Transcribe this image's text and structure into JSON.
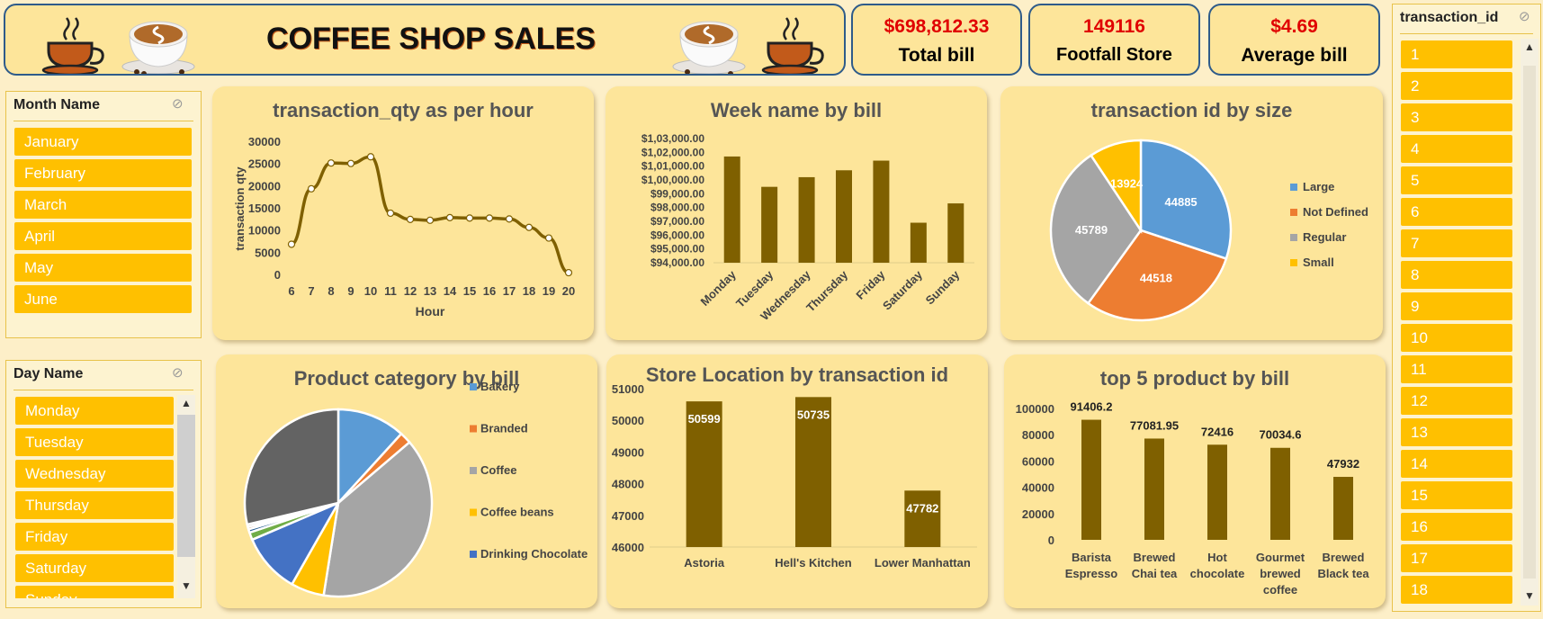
{
  "header": {
    "title": "COFFEE SHOP SALES"
  },
  "kpis": [
    {
      "value": "$698,812.33",
      "label": "Total bill"
    },
    {
      "value": "149116",
      "label": "Footfall Store"
    },
    {
      "value": "$4.69",
      "label": "Average bill"
    }
  ],
  "colors": {
    "card": "#fde59a",
    "bar": "#7f6000",
    "slicer_item": "#ffc000",
    "kpi_value": "#e00000",
    "border": "#2e5b8a"
  },
  "month_slicer": {
    "title": "Month Name",
    "items": [
      "January",
      "February",
      "March",
      "April",
      "May",
      "June"
    ]
  },
  "day_slicer": {
    "title": "Day Name",
    "items": [
      "Monday",
      "Tuesday",
      "Wednesday",
      "Thursday",
      "Friday",
      "Saturday",
      "Sunday"
    ]
  },
  "transaction_slicer": {
    "title": "transaction_id",
    "items": [
      "1",
      "2",
      "3",
      "4",
      "5",
      "6",
      "7",
      "8",
      "9",
      "10",
      "11",
      "12",
      "13",
      "14",
      "15",
      "16",
      "17",
      "18"
    ]
  },
  "icons": {
    "clear_filter": "filter-clear-icon",
    "cup": "coffee-cup-icon",
    "latte": "latte-photo"
  },
  "chart_data": [
    {
      "type": "line",
      "title": "transaction_qty as per hour",
      "xlabel": "Hour",
      "ylabel": "transaction qty",
      "x": [
        6,
        7,
        8,
        9,
        10,
        11,
        12,
        13,
        14,
        15,
        16,
        17,
        18,
        19,
        20
      ],
      "y": [
        7000,
        19500,
        25300,
        25200,
        26700,
        14000,
        12600,
        12400,
        13000,
        12900,
        12900,
        12700,
        10800,
        8400,
        600
      ],
      "yticks": [
        "0",
        "5000",
        "10000",
        "15000",
        "20000",
        "25000",
        "30000"
      ],
      "ylim": [
        0,
        30000
      ]
    },
    {
      "type": "bar",
      "title": "Week name by bill",
      "categories": [
        "Monday",
        "Tuesday",
        "Wednesday",
        "Thursday",
        "Friday",
        "Saturday",
        "Sunday"
      ],
      "values": [
        101700,
        99500,
        100200,
        100700,
        101400,
        96900,
        98300
      ],
      "yticks": [
        "$94,000.00",
        "$95,000.00",
        "$96,000.00",
        "$97,000.00",
        "$98,000.00",
        "$99,000.00",
        "$1,00,000.00",
        "$1,01,000.00",
        "$1,02,000.00",
        "$1,03,000.00"
      ],
      "ylim": [
        94000,
        103000
      ]
    },
    {
      "type": "pie",
      "title": "transaction id by size",
      "labels": [
        "Large",
        "Not Defined",
        "Regular",
        "Small"
      ],
      "values": [
        44885,
        44518,
        45789,
        13924
      ],
      "value_labels": [
        "44885",
        "44518",
        "45789",
        "13924"
      ],
      "colors": [
        "#5b9bd5",
        "#ed7d31",
        "#a5a5a5",
        "#ffc000"
      ],
      "legend": "right"
    },
    {
      "type": "pie",
      "title": "Product category by bill",
      "labels": [
        "Bakery",
        "Branded",
        "Coffee",
        "Coffee beans",
        "Drinking Chocolate"
      ],
      "values": [
        82000,
        14000,
        270000,
        40000,
        72000,
        9000,
        4000,
        3000,
        3000,
        200000
      ],
      "colors": [
        "#5b9bd5",
        "#ed7d31",
        "#a5a5a5",
        "#ffc000",
        "#4472c4",
        "#70ad47",
        "#255e91",
        "#9e480e",
        "#bfbfbf",
        "#636363"
      ],
      "legend_colors": [
        "#5b9bd5",
        "#ed7d31",
        "#a5a5a5",
        "#ffc000",
        "#4472c4"
      ],
      "legend": "right"
    },
    {
      "type": "bar",
      "title": "Store Location by transaction id",
      "categories": [
        "Astoria",
        "Hell's Kitchen",
        "Lower Manhattan"
      ],
      "values": [
        50599,
        50735,
        47782
      ],
      "value_labels": [
        "50599",
        "50735",
        "47782"
      ],
      "yticks": [
        "46000",
        "47000",
        "48000",
        "49000",
        "50000",
        "51000"
      ],
      "ylim": [
        46000,
        51000
      ]
    },
    {
      "type": "bar",
      "title": "top 5 product by bill",
      "categories": [
        "Barista Espresso",
        "Brewed Chai tea",
        "Hot chocolate",
        "Gourmet brewed coffee",
        "Brewed Black tea"
      ],
      "category_lines": [
        [
          "Barista",
          "Espresso"
        ],
        [
          "Brewed",
          "Chai tea"
        ],
        [
          "Hot",
          "chocolate"
        ],
        [
          "Gourmet",
          "brewed",
          "coffee"
        ],
        [
          "Brewed",
          "Black tea"
        ]
      ],
      "values": [
        91406.2,
        77081.95,
        72416,
        70034.6,
        47932
      ],
      "value_labels": [
        "91406.2",
        "77081.95",
        "72416",
        "70034.6",
        "47932"
      ],
      "yticks": [
        "0",
        "20000",
        "40000",
        "60000",
        "80000",
        "100000"
      ],
      "ylim": [
        0,
        100000
      ]
    }
  ]
}
